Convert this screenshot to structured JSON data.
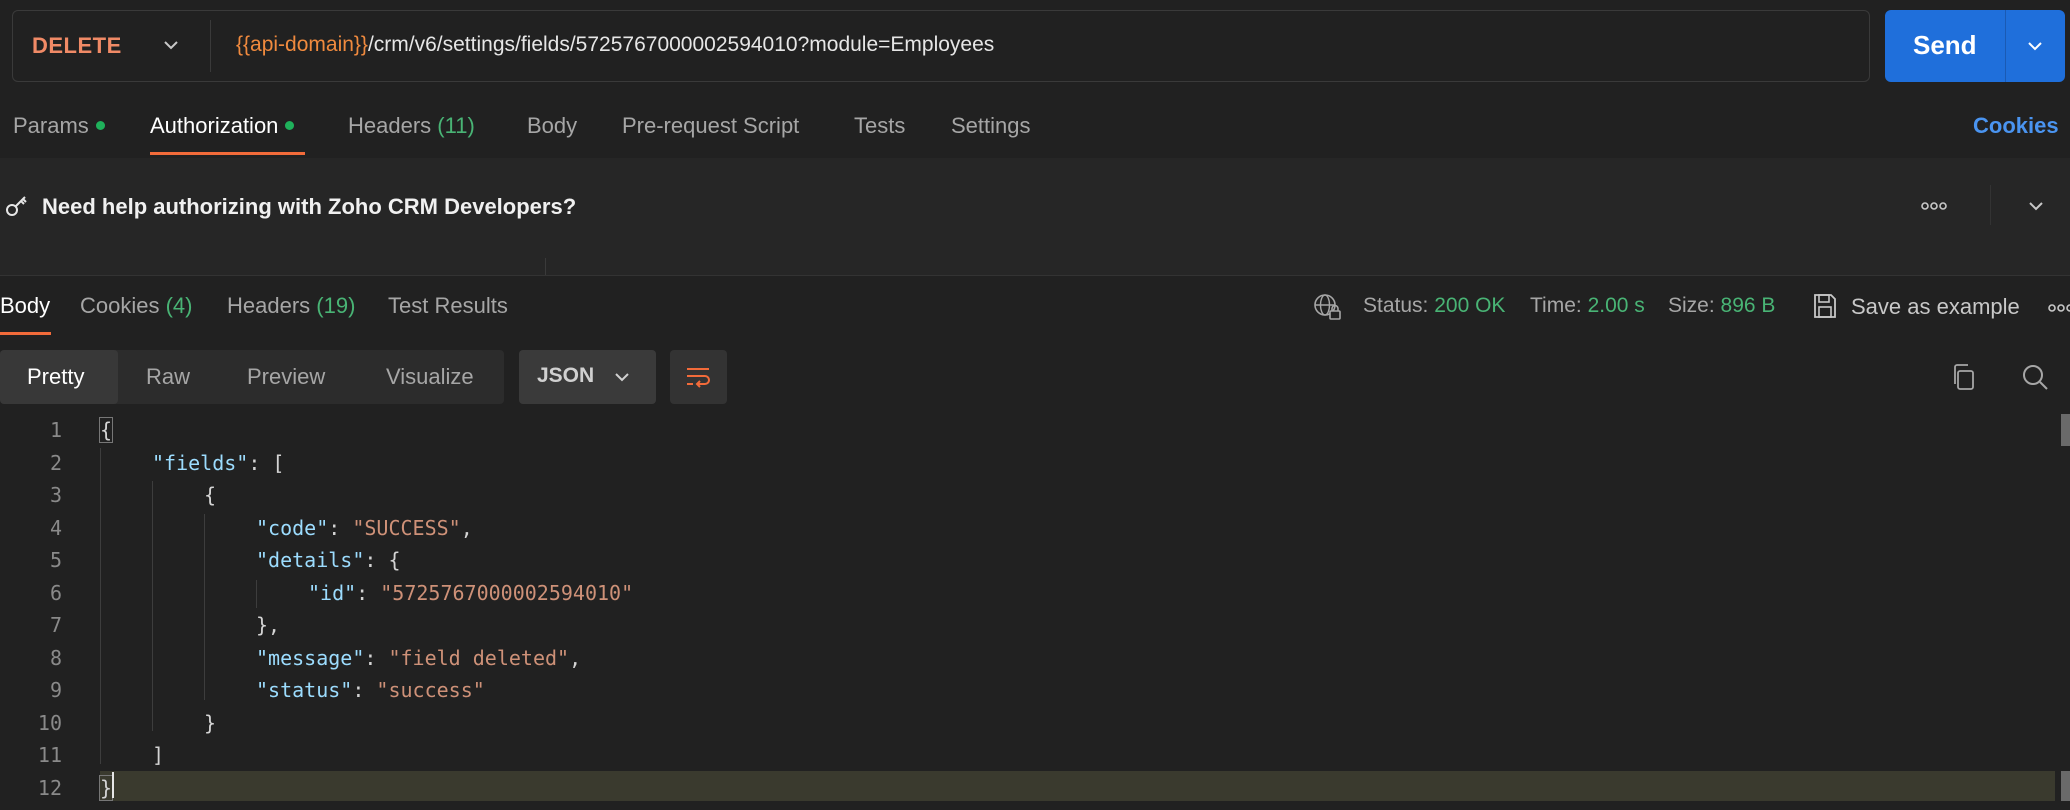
{
  "request": {
    "method": "DELETE",
    "url_variable": "{{api-domain}}",
    "url_path": "/crm/v6/settings/fields/5725767000002594010?module=Employees",
    "send_label": "Send"
  },
  "request_tabs": [
    {
      "label": "Params",
      "dot": true
    },
    {
      "label": "Authorization",
      "dot": true
    },
    {
      "label": "Headers",
      "count": "(11)"
    },
    {
      "label": "Body"
    },
    {
      "label": "Pre-request Script"
    },
    {
      "label": "Tests"
    },
    {
      "label": "Settings"
    }
  ],
  "cookies_link": "Cookies",
  "auth_help": {
    "title": "Need help authorizing with Zoho CRM Developers?"
  },
  "response_tabs": [
    {
      "label": "Body"
    },
    {
      "label": "Cookies",
      "count": "(4)"
    },
    {
      "label": "Headers",
      "count": "(19)"
    },
    {
      "label": "Test Results"
    }
  ],
  "response_meta": {
    "status_label": "Status:",
    "status_value": "200 OK",
    "time_label": "Time:",
    "time_value": "2.00 s",
    "size_label": "Size:",
    "size_value": "896 B",
    "save_label": "Save as example"
  },
  "format_modes": [
    "Pretty",
    "Raw",
    "Preview",
    "Visualize"
  ],
  "format_type": "JSON",
  "line_numbers": [
    "1",
    "2",
    "3",
    "4",
    "5",
    "6",
    "7",
    "8",
    "9",
    "10",
    "11",
    "12"
  ],
  "response_body": {
    "l1": "{",
    "l2_key": "\"fields\"",
    "l2_rest": ": [",
    "l3": "{",
    "l4_key": "\"code\"",
    "l4_val": "\"SUCCESS\"",
    "l5_key": "\"details\"",
    "l5_rest": ": {",
    "l6_key": "\"id\"",
    "l6_val": "\"5725767000002594010\"",
    "l7": "},",
    "l8_key": "\"message\"",
    "l8_val": "\"field deleted\"",
    "l9_key": "\"status\"",
    "l9_val": "\"success\"",
    "l10": "}",
    "l11": "]",
    "l12": "}"
  },
  "colors": {
    "accent_orange": "#f26b3a",
    "send_blue": "#1f6fdb",
    "status_green": "#49b475"
  }
}
